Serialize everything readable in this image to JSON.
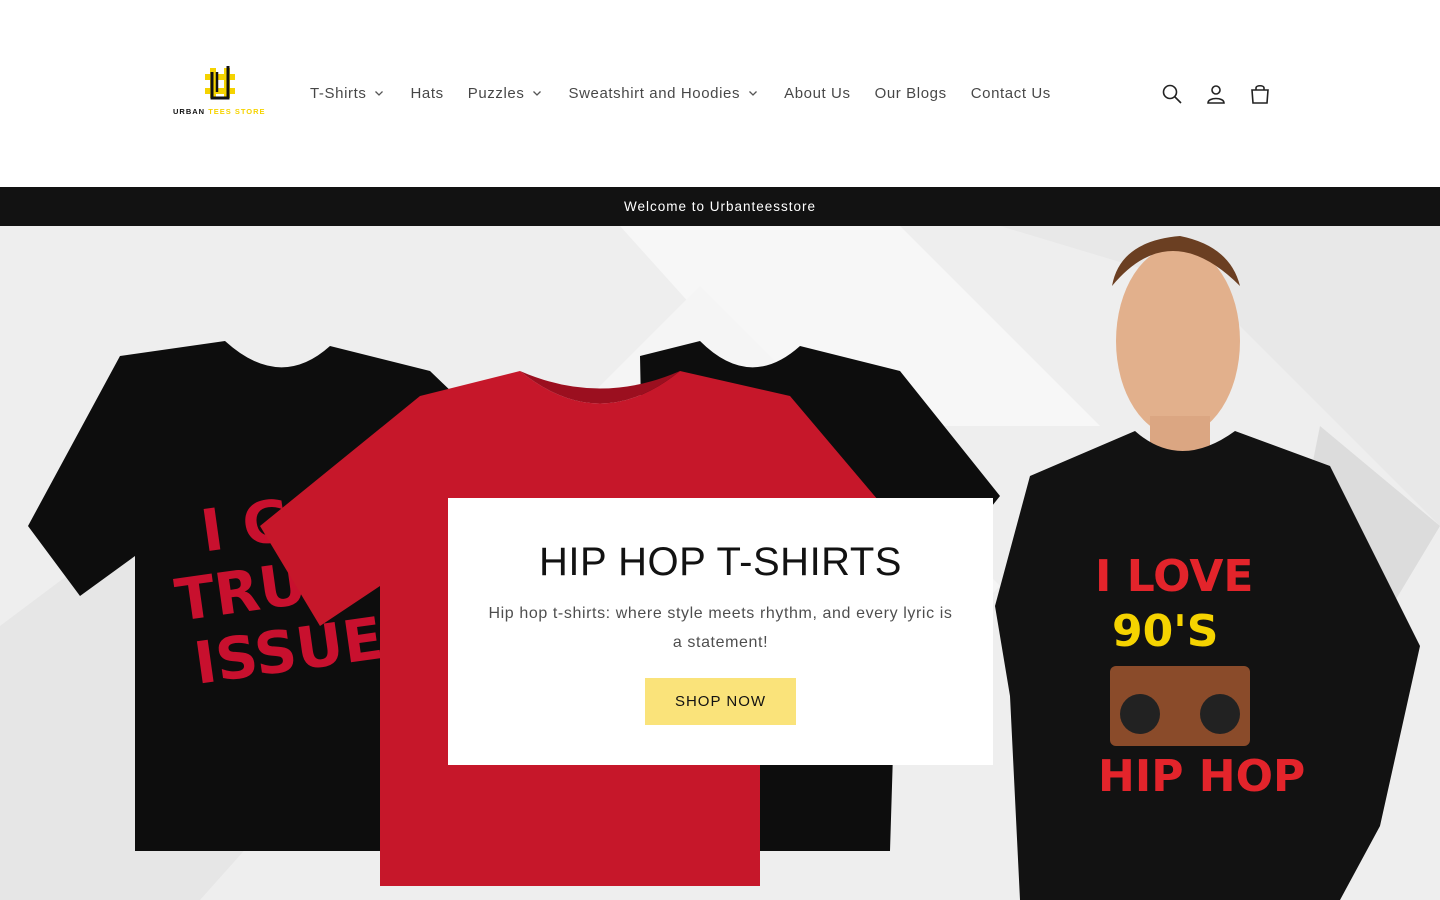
{
  "brand": {
    "word1": "URBAN",
    "word2": "TEES STORE",
    "accent": "#f5d300"
  },
  "nav": {
    "items": [
      {
        "label": "T-Shirts",
        "has_dropdown": true
      },
      {
        "label": "Hats",
        "has_dropdown": false
      },
      {
        "label": "Puzzles",
        "has_dropdown": true
      },
      {
        "label": "Sweatshirt and Hoodies",
        "has_dropdown": true
      },
      {
        "label": "About Us",
        "has_dropdown": false
      },
      {
        "label": "Our Blogs",
        "has_dropdown": false
      },
      {
        "label": "Contact Us",
        "has_dropdown": false
      }
    ]
  },
  "header_icons": [
    "search-icon",
    "account-icon",
    "cart-icon"
  ],
  "announcement": {
    "text": "Welcome to Urbanteesstore"
  },
  "hero": {
    "title": "HIP HOP T-SHIRTS",
    "subtitle": "Hip hop t-shirts: where style meets rhythm, and every lyric is a statement!",
    "button_label": "SHOP NOW",
    "button_color": "#fae37a",
    "shirt_text_left": [
      "I G",
      "TRUS",
      "ISSUES"
    ],
    "shirt_text_right": [
      "I LOVE",
      "90'S",
      "HIP HOP"
    ]
  }
}
